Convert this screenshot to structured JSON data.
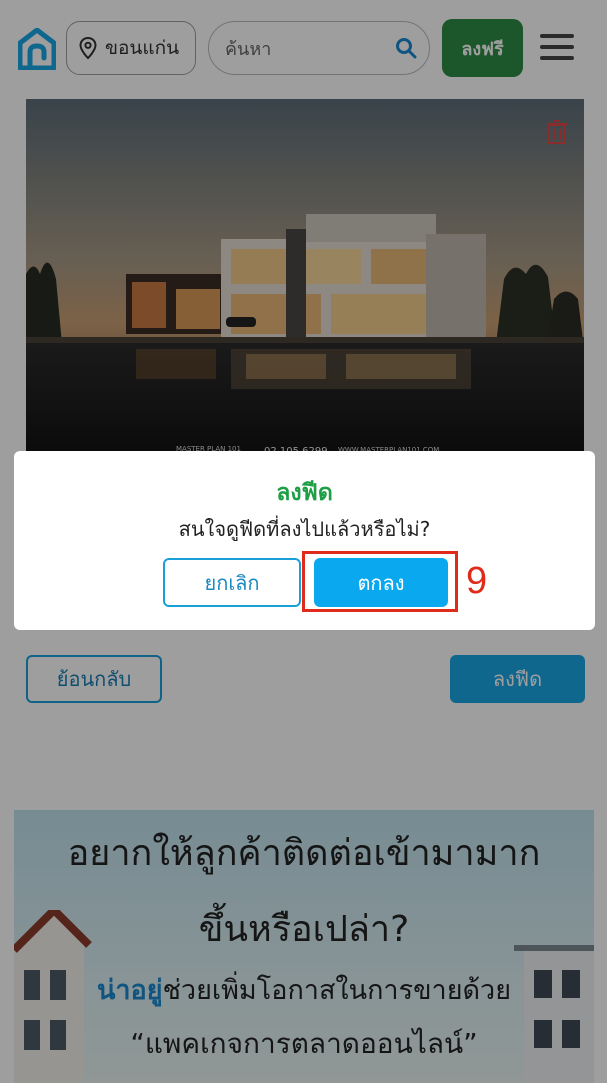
{
  "header": {
    "location_label": "ขอนแก่น",
    "search_placeholder": "ค้นหา",
    "signup_label": "ลงฟรี"
  },
  "listing": {
    "watermark_phone": "02 105 6299",
    "watermark_site": "WWW.MASTERPLAN101.COM",
    "watermark_brand": "MASTER PLAN 101"
  },
  "actions": {
    "back_label": "ย้อนกลับ",
    "feed_label": "ลงฟีด"
  },
  "dialog": {
    "title": "ลงฟีด",
    "message": "สนใจดูฟีดที่ลงไปแล้วหรือไม่?",
    "cancel_label": "ยกเลิก",
    "ok_label": "ตกลง"
  },
  "banner": {
    "headline_1": "อยากให้ลูกค้าติดต่อเข้ามามาก",
    "headline_2": "ขึ้นหรือเปล่า?",
    "brand": "น่าอยู่",
    "line_3_rest": "ช่วยเพิ่มโอกาสในการขายด้วย",
    "line_4": "“แพคเกจการตลาดออนไลน์”"
  },
  "annotation": {
    "step_number": "9"
  },
  "colors": {
    "green": "#2e8b46",
    "blue": "#0aa9ef",
    "annotation_red": "#e02a1a"
  }
}
